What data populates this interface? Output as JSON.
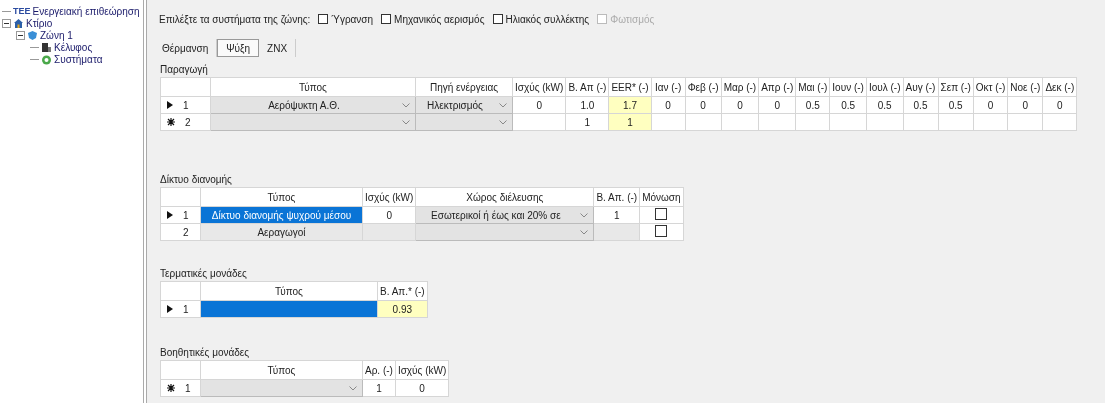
{
  "tree": [
    {
      "label": "Ενεργειακή επιθεώρηση",
      "logo": "ΤΕΕ",
      "kind": "logo"
    },
    {
      "label": "Κτίριο",
      "kind": "house",
      "expanded": true,
      "children": [
        {
          "label": "Ζώνη 1",
          "kind": "zone",
          "expanded": true,
          "children": [
            {
              "label": "Κέλυφος",
              "kind": "building"
            },
            {
              "label": "Συστήματα",
              "kind": "systems"
            }
          ]
        }
      ]
    }
  ],
  "systems": {
    "prompt": "Επιλέξτε τα συστήματα της ζώνης:",
    "options": [
      {
        "label": "Ύγρανση",
        "checked": false,
        "disabled": false
      },
      {
        "label": "Μηχανικός αερισμός",
        "checked": false,
        "disabled": false
      },
      {
        "label": "Ηλιακός συλλέκτης",
        "checked": false,
        "disabled": false
      },
      {
        "label": "Φωτισμός",
        "checked": false,
        "disabled": true
      }
    ]
  },
  "tabs": [
    {
      "label": "Θέρμανση",
      "selected": false
    },
    {
      "label": "Ψύξη",
      "selected": true
    },
    {
      "label": "ZNX",
      "selected": false
    }
  ],
  "tables": [
    {
      "title": "Παραγωγή",
      "columns": [
        {
          "label": "Τύπος"
        },
        {
          "label": "Πηγή ενέργειας"
        },
        {
          "label": "Ισχύς (kW)"
        },
        {
          "label": "Β. Απ (-)"
        },
        {
          "label": "EER* (-)",
          "highlight": true
        },
        {
          "label": "Ιαν (-)"
        },
        {
          "label": "Φεβ (-)"
        },
        {
          "label": "Μαρ (-)"
        },
        {
          "label": "Απρ (-)"
        },
        {
          "label": "Μαι (-)"
        },
        {
          "label": "Ιουν (-)"
        },
        {
          "label": "Ιουλ (-)"
        },
        {
          "label": "Αυγ (-)"
        },
        {
          "label": "Σεπ (-)"
        },
        {
          "label": "Οκτ (-)"
        },
        {
          "label": "Νοε (-)"
        },
        {
          "label": "Δεκ (-)"
        }
      ],
      "rows": [
        {
          "kind": "current",
          "number": "1",
          "disabled": false,
          "cells": [
            {
              "kind": "combo",
              "value": "Αερόψυκτη Α.Θ."
            },
            {
              "kind": "combo",
              "value": "Ηλεκτρισμός"
            },
            {
              "kind": "text",
              "value": "0"
            },
            {
              "kind": "text",
              "value": "1.0"
            },
            {
              "kind": "text",
              "value": "1.7"
            },
            {
              "kind": "text",
              "value": "0"
            },
            {
              "kind": "text",
              "value": "0"
            },
            {
              "kind": "text",
              "value": "0"
            },
            {
              "kind": "text",
              "value": "0"
            },
            {
              "kind": "text",
              "value": "0.5"
            },
            {
              "kind": "text",
              "value": "0.5"
            },
            {
              "kind": "text",
              "value": "0.5"
            },
            {
              "kind": "text",
              "value": "0.5"
            },
            {
              "kind": "text",
              "value": "0.5"
            },
            {
              "kind": "text",
              "value": "0"
            },
            {
              "kind": "text",
              "value": "0"
            },
            {
              "kind": "text",
              "value": "0"
            }
          ]
        },
        {
          "kind": "new",
          "number": "2",
          "disabled": false,
          "cells": [
            {
              "kind": "combo"
            },
            {
              "kind": "combo"
            },
            {
              "kind": "text"
            },
            {
              "kind": "text",
              "value": "1"
            },
            {
              "kind": "text",
              "value": "1"
            },
            {
              "kind": "text"
            },
            {
              "kind": "text"
            },
            {
              "kind": "text"
            },
            {
              "kind": "text"
            },
            {
              "kind": "text"
            },
            {
              "kind": "text"
            },
            {
              "kind": "text"
            },
            {
              "kind": "text"
            },
            {
              "kind": "text"
            },
            {
              "kind": "text"
            },
            {
              "kind": "text"
            },
            {
              "kind": "text"
            }
          ]
        }
      ]
    },
    {
      "title": "Δίκτυο διανομής",
      "columns": [
        {
          "label": "Τύπος"
        },
        {
          "label": "Ισχύς (kW)"
        },
        {
          "label": "Χώρος διέλευσης"
        },
        {
          "label": "Β. Απ. (-)"
        },
        {
          "label": "Μόνωση"
        }
      ],
      "rows": [
        {
          "kind": "current",
          "number": "1",
          "disabled": false,
          "cells": [
            {
              "kind": "text",
              "value": "Δίκτυο διανομής ψυχρού μέσου",
              "selected": true
            },
            {
              "kind": "text",
              "value": "0",
              "selected": false
            },
            {
              "kind": "combo",
              "value": "Εσωτερικοί  ή έως και 20% σε"
            },
            {
              "kind": "text",
              "value": "1",
              "selected": false
            },
            {
              "kind": "check",
              "checked": false
            }
          ]
        },
        {
          "kind": "plain",
          "number": "2",
          "disabled": true,
          "cells": [
            {
              "kind": "text",
              "value": "Αεραγωγοί",
              "selected": false
            },
            {
              "kind": "text",
              "selected": false
            },
            {
              "kind": "combo"
            },
            {
              "kind": "text",
              "selected": false
            },
            {
              "kind": "check",
              "checked": false
            }
          ]
        }
      ]
    },
    {
      "title": "Τερματικές μονάδες",
      "columns": [
        {
          "label": "Τύπος"
        },
        {
          "label": "Β. Απ.* (-)",
          "highlight": true
        }
      ],
      "rows": [
        {
          "kind": "current",
          "number": "1",
          "disabled": false,
          "cells": [
            {
              "kind": "text",
              "selected": true
            },
            {
              "kind": "text",
              "value": "0.93",
              "selected": false
            }
          ]
        }
      ]
    },
    {
      "title": "Βοηθητικές μονάδες",
      "columns": [
        {
          "label": "Τύπος"
        },
        {
          "label": "Αρ. (-)"
        },
        {
          "label": "Ισχύς (kW)"
        }
      ],
      "rows": [
        {
          "kind": "new",
          "number": "1",
          "disabled": false,
          "cells": [
            {
              "kind": "combo"
            },
            {
              "kind": "text",
              "value": "1"
            },
            {
              "kind": "text",
              "value": "0"
            }
          ]
        }
      ]
    }
  ]
}
